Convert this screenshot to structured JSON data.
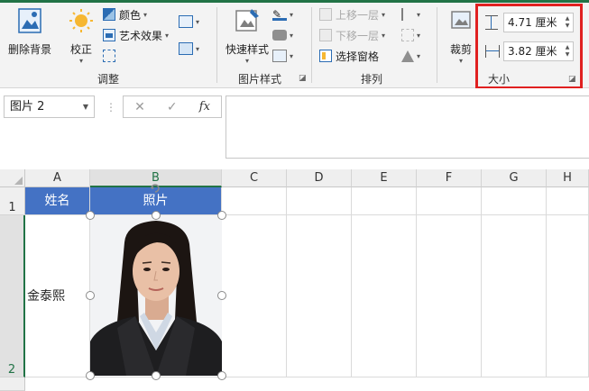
{
  "ribbon": {
    "adjust": {
      "remove_bg_label": "删除背景",
      "corrections_label": "校正",
      "color_label": "颜色",
      "artistic_label": "艺术效果",
      "group_label": "调整"
    },
    "picture_styles": {
      "quick_styles_label": "快速样式",
      "group_label": "图片样式"
    },
    "arrange": {
      "bring_forward_label": "上移一层",
      "send_backward_label": "下移一层",
      "selection_pane_label": "选择窗格",
      "group_label": "排列"
    },
    "size": {
      "crop_label": "裁剪",
      "height_value": "4.71 厘米",
      "width_value": "3.82 厘米",
      "group_label": "大小"
    }
  },
  "formula_bar": {
    "name_box_value": "图片 2",
    "fx_label": "fx",
    "cancel_symbol": "✕",
    "enter_symbol": "✓",
    "formula_value": ""
  },
  "sheet": {
    "columns": [
      "A",
      "B",
      "C",
      "D",
      "E",
      "F",
      "G",
      "H"
    ],
    "rows": [
      "1",
      "2"
    ],
    "header_row": {
      "a1": "姓名",
      "b1": "照片"
    },
    "a2": "金泰熙"
  },
  "colors": {
    "header_fill": "#4472c4",
    "header_text": "#ffffff",
    "highlight_border": "#e02020",
    "accent_green": "#217346"
  },
  "icons": {
    "remove_bg": "remove-background-icon",
    "corrections": "sun-icon",
    "color": "color-icon",
    "artistic": "artistic-effects-icon",
    "quick_styles": "quick-styles-icon",
    "selection_pane": "selection-pane-icon",
    "crop": "crop-icon",
    "height": "shape-height-icon",
    "width": "shape-width-icon",
    "dialog_launcher": "dialog-launcher-icon"
  }
}
